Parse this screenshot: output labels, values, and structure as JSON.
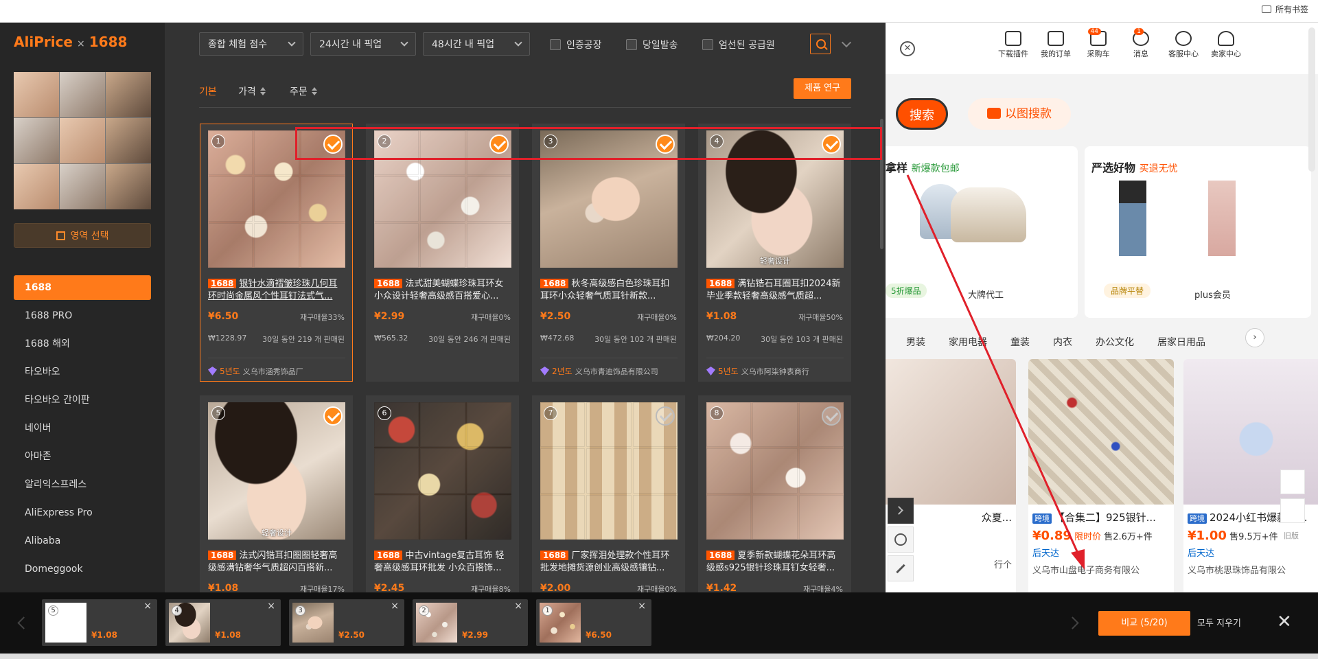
{
  "browser": {
    "bookmark_folder": "所有书签"
  },
  "background_page": {
    "header_links": [
      {
        "label": "下载插件",
        "badge": ""
      },
      {
        "label": "我的订单",
        "badge": ""
      },
      {
        "label": "采购车",
        "badge": "44"
      },
      {
        "label": "消息",
        "badge": "1"
      },
      {
        "label": "客服中心",
        "badge": ""
      },
      {
        "label": "卖家中心",
        "badge": ""
      }
    ],
    "search_button": "搜索",
    "image_search_button": "以图搜款",
    "section1_title": "拿样",
    "section1_sub": "新爆款包邮",
    "section2_title": "严选好物",
    "section2_sub": "买退无忧",
    "section1_tag": "5折爆品",
    "promo_items": [
      {
        "label": "大牌代工",
        "tag": ""
      },
      {
        "label": "品牌平替",
        "tag": ""
      },
      {
        "label": "plus会员",
        "tag": ""
      }
    ],
    "categories": [
      "男装",
      "家用电器",
      "童装",
      "内衣",
      "办公文化",
      "居家日用品"
    ],
    "products": [
      {
        "title": "众夏...",
        "price": "",
        "sub": "",
        "shop": "行个"
      },
      {
        "title": "【合集二】925银针...",
        "price": "¥0.89",
        "price_note": "限时价",
        "sold": "售2.6万+件",
        "ship": "后天达",
        "shop": "义乌市山盘电子商务有限公"
      },
      {
        "title": "2024小红书爆款渐...",
        "price": "¥1.00",
        "price_note": "",
        "sold": "售9.5万+件",
        "ship": "后天达",
        "shop": "义乌市桃思珠饰品有限公"
      }
    ],
    "tag_label": "跨境",
    "right_tool_label": "旧版"
  },
  "extension": {
    "logo_main": "AliPrice",
    "logo_sep": "×",
    "logo_site": "1688",
    "region_button": "영역 선택",
    "platforms": [
      "1688",
      "1688 PRO",
      "1688 해외",
      "타오바오",
      "타오바오 간이판",
      "네이버",
      "아마존",
      "알리익스프레스",
      "AliExpress Pro",
      "Alibaba",
      "Domeggook"
    ],
    "active_platform": "1688",
    "filters": {
      "sort_dropdown": "종합 체험 점수",
      "pickup_24": "24시간 내 픽업",
      "pickup_48": "48시간 내 픽업",
      "checkboxes": [
        "인증공장",
        "당일발송",
        "엄선된 공급원"
      ]
    },
    "sort_tabs": [
      "기본",
      "가격",
      "주문"
    ],
    "research_button": "제품 연구",
    "source_tag": "1688",
    "products": [
      {
        "num": "1",
        "title": "银针水滴褶皱珍珠几何耳环时尚金属风个性耳钉法式气...",
        "price": "¥6.50",
        "repurchase": "재구매율33%",
        "value": "₩1228.97",
        "sold": "30일 동안 219 개 판매된",
        "years": "5년도",
        "shop": "义乌市涵秀饰品厂",
        "checked": true,
        "caption": ""
      },
      {
        "num": "2",
        "title": "法式甜美蝴蝶珍珠耳环女小众设计轻奢高级感百搭爱心...",
        "price": "¥2.99",
        "repurchase": "재구매율0%",
        "value": "₩565.32",
        "sold": "30일 동안 246 개 판매된",
        "years": "",
        "shop": "",
        "checked": true,
        "caption": ""
      },
      {
        "num": "3",
        "title": "秋冬高级感白色珍珠耳扣耳环小众轻奢气质耳针新款...",
        "price": "¥2.50",
        "repurchase": "재구매율0%",
        "value": "₩472.68",
        "sold": "30일 동안 102 개 판매된",
        "years": "2년도",
        "shop": "义乌市青迪饰品有限公司",
        "checked": true,
        "caption": ""
      },
      {
        "num": "4",
        "title": "满钻锆石耳圈耳扣2024新毕业季款轻奢高级感气质超...",
        "price": "¥1.08",
        "repurchase": "재구매율50%",
        "value": "₩204.20",
        "sold": "30일 동안 103 개 판매된",
        "years": "5년도",
        "shop": "义乌市阿柒钟表商行",
        "checked": true,
        "caption": "轻奢设计"
      },
      {
        "num": "5",
        "title": "法式闪锆耳扣圈圈轻奢高级感满钻奢华气质超闪百搭新...",
        "price": "¥1.08",
        "repurchase": "재구매율17%",
        "checked": true,
        "caption": "轻奢设计"
      },
      {
        "num": "6",
        "title": "中古vintage复古耳饰 轻奢高级感耳环批发 小众百搭饰...",
        "price": "¥2.45",
        "repurchase": "재구매율8%",
        "checked": false,
        "caption": ""
      },
      {
        "num": "7",
        "title": "厂家挥泪处理款个性耳环批发地摊货源创业高级感镶钻...",
        "price": "¥2.00",
        "repurchase": "재구매율0%",
        "checked": false,
        "caption": ""
      },
      {
        "num": "8",
        "title": "夏季新款蝴蝶花朵耳环高级感s925银针珍珠耳钉女轻奢...",
        "price": "¥1.42",
        "repurchase": "재구매율4%",
        "checked": false,
        "caption": ""
      }
    ]
  },
  "compare_bar": {
    "slots": [
      {
        "num": "5",
        "price": "¥1.08"
      },
      {
        "num": "4",
        "price": "¥1.08"
      },
      {
        "num": "3",
        "price": "¥2.50"
      },
      {
        "num": "2",
        "price": "¥2.99"
      },
      {
        "num": "1",
        "price": "¥6.50"
      }
    ],
    "compare_button": "비교 (5/20)",
    "clear_all": "모두 지우기"
  },
  "colors": {
    "accent": "#ff7a1a",
    "annotation": "#e0202a",
    "brand_1688": "#ff5000"
  }
}
